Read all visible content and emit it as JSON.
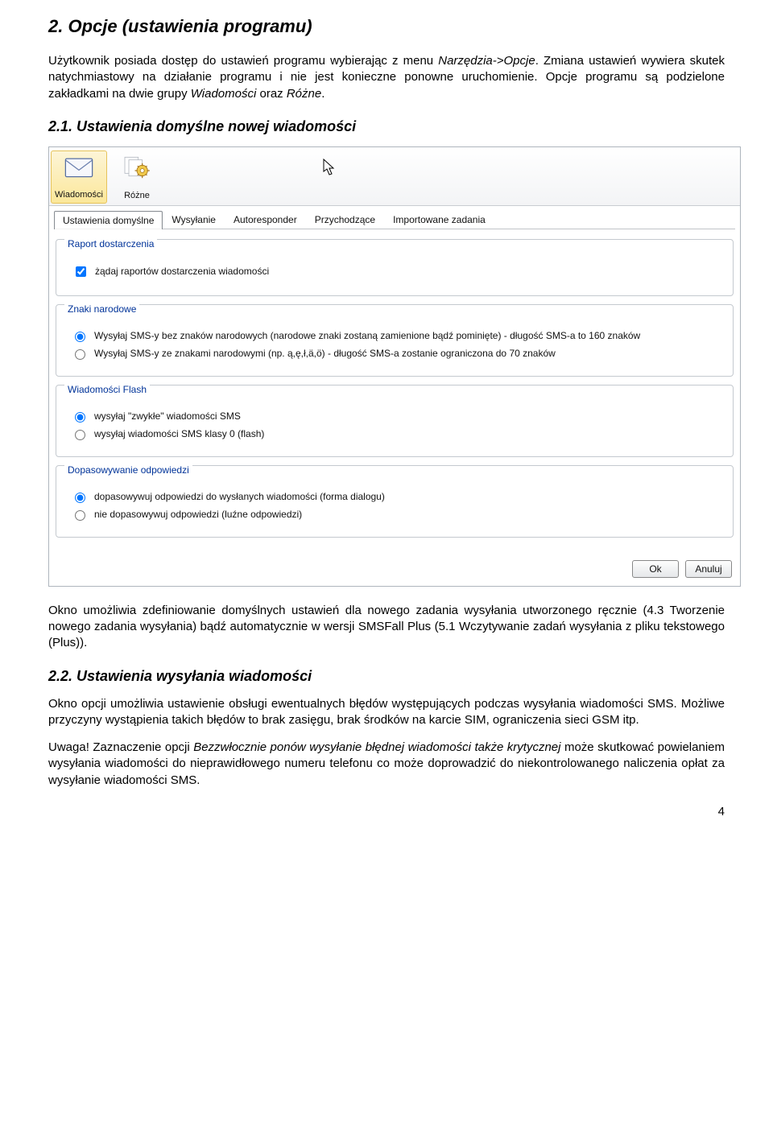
{
  "heading1": "2. Opcje (ustawienia programu)",
  "intro_plain1": "Użytkownik posiada dostęp do ustawień programu wybierając z menu ",
  "intro_italic1": "Narzędzia->Opcje",
  "intro_plain2": ". Zmiana ustawień wywiera skutek natychmiastowy na działanie programu i nie jest konieczne ponowne uruchomienie. Opcje programu są podzielone zakładkami na dwie grupy ",
  "intro_italic2": "Wiadomości",
  "intro_plain3": " oraz ",
  "intro_italic3": "Różne",
  "intro_plain4": ".",
  "heading21": "2.1. Ustawienia domyślne nowej wiadomości",
  "toolbar": {
    "wiadomosci": "Wiadomości",
    "rozne": "Różne"
  },
  "tabs": [
    "Ustawienia domyślne",
    "Wysyłanie",
    "Autoresponder",
    "Przychodzące",
    "Importowane zadania"
  ],
  "fs1": {
    "title": "Raport dostarczenia",
    "check1": "żądaj raportów dostarczenia wiadomości"
  },
  "fs2": {
    "title": "Znaki narodowe",
    "r1": "Wysyłaj SMS-y bez znaków narodowych (narodowe znaki zostaną zamienione bądź pominięte) - długość SMS-a to 160 znaków",
    "r2": "Wysyłaj SMS-y ze znakami narodowymi (np. ą,ę,ł,ä,ö) - długość SMS-a zostanie ograniczona do 70 znaków"
  },
  "fs3": {
    "title": "Wiadomości Flash",
    "r1": "wysyłaj \"zwykłe\" wiadomości SMS",
    "r2": "wysyłaj wiadomości SMS klasy 0 (flash)"
  },
  "fs4": {
    "title": "Dopasowywanie odpowiedzi",
    "r1": "dopasowywuj odpowiedzi do wysłanych wiadomości (forma dialogu)",
    "r2": "nie dopasowywuj odpowiedzi (luźne odpowiedzi)"
  },
  "btn_ok": "Ok",
  "btn_cancel": "Anuluj",
  "para_after_shot": "Okno umożliwia zdefiniowanie domyślnych ustawień dla nowego zadania wysyłania utworzonego ręcznie (4.3 Tworzenie nowego zadania wysyłania) bądź automatycznie w wersji SMSFall Plus (5.1 Wczytywanie zadań wysyłania z pliku tekstowego (Plus)).",
  "heading22": "2.2. Ustawienia wysyłania wiadomości",
  "para22": "Okno opcji umożliwia ustawienie obsługi ewentualnych błędów występujących podczas wysyłania wiadomości SMS. Możliwe przyczyny wystąpienia takich błędów to brak zasięgu, brak środków na karcie SIM, ograniczenia sieci GSM itp.",
  "uwaga_pre": "Uwaga! Zaznaczenie opcji ",
  "uwaga_ital": "Bezzwłocznie ponów wysyłanie błędnej wiadomości także krytycznej",
  "uwaga_post": " może skutkować powielaniem wysyłania wiadomości do nieprawidłowego numeru telefonu co może doprowadzić do niekontrolowanego naliczenia opłat za wysyłanie wiadomości SMS.",
  "page_num": "4"
}
